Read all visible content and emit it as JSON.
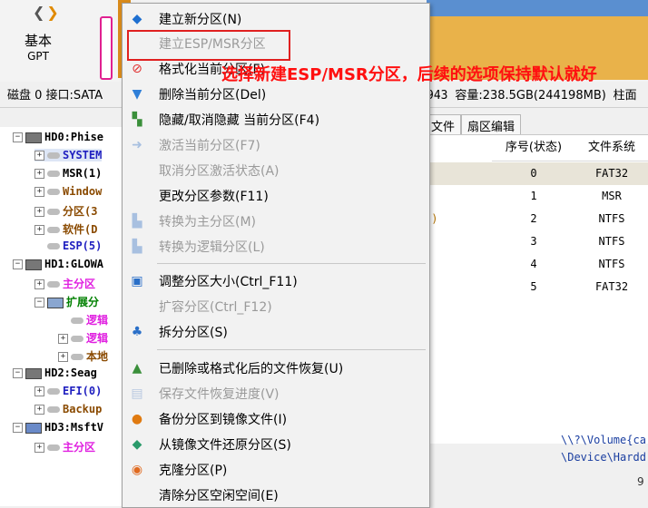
{
  "toolbar": {
    "nav_back": "❮",
    "nav_forward": "❯",
    "disk_type_title": "基本",
    "disk_type_sub": "GPT"
  },
  "disk_info": {
    "left_text": "磁盘 0 接口:SATA",
    "right_partial": "943",
    "capacity_label": "容量:238.5GB(244198MB)",
    "trailing": "柱面"
  },
  "tree": {
    "hd0": "HD0:Phise",
    "hd0_parts": [
      "SYSTEM",
      "MSR(1)",
      "Window",
      "分区(3",
      "软件(D",
      "ESP(5)"
    ],
    "hd1": "HD1:GLOWA",
    "hd1_parts": [
      "主分区",
      "扩展分"
    ],
    "hd1_sub": [
      "逻辑",
      "逻辑",
      "本地"
    ],
    "hd2": "HD2:Seag",
    "hd2_parts": [
      "EFI(0)",
      "Backup"
    ],
    "hd3": "HD3:MsftV",
    "hd3_parts": [
      "主分区"
    ]
  },
  "tabs": [
    "文件",
    "扇区编辑"
  ],
  "table": {
    "headers": [
      "序号(状态)",
      "文件系统"
    ],
    "rows": [
      {
        "index": "0",
        "fs": "FAT32"
      },
      {
        "index": "1",
        "fs": "MSR"
      },
      {
        "index": "2",
        "fs": "NTFS"
      },
      {
        "index": "3",
        "fs": "NTFS"
      },
      {
        "index": "4",
        "fs": "NTFS"
      },
      {
        "index": "5",
        "fs": "FAT32"
      }
    ],
    "fragment": ":)"
  },
  "volume_paths": [
    "\\\\?\\Volume{ca",
    "\\Device\\Hardd"
  ],
  "status_num": "9",
  "context_menu": {
    "items": [
      {
        "label": "建立新分区(N)",
        "icon": "new-partition-icon",
        "disabled": false
      },
      {
        "label": "建立ESP/MSR分区",
        "icon": "esp-msr-icon",
        "disabled": true
      },
      {
        "label": "格式化当前分区(F)",
        "icon": "format-icon",
        "disabled": false
      },
      {
        "label": "删除当前分区(Del)",
        "icon": "trash-icon",
        "disabled": false
      },
      {
        "label": "隐藏/取消隐藏 当前分区(F4)",
        "icon": "hide-icon",
        "disabled": false
      },
      {
        "label": "激活当前分区(F7)",
        "icon": "activate-icon",
        "disabled": true
      },
      {
        "label": "取消分区激活状态(A)",
        "icon": "deactivate-icon",
        "disabled": true
      },
      {
        "label": "更改分区参数(F11)",
        "icon": "params-icon",
        "disabled": false
      },
      {
        "label": "转换为主分区(M)",
        "icon": "to-primary-icon",
        "disabled": true
      },
      {
        "label": "转换为逻辑分区(L)",
        "icon": "to-logical-icon",
        "disabled": true
      },
      {
        "label": "调整分区大小(Ctrl_F11)",
        "icon": "resize-icon",
        "disabled": false
      },
      {
        "label": "扩容分区(Ctrl_F12)",
        "icon": "extend-icon",
        "disabled": true
      },
      {
        "label": "拆分分区(S)",
        "icon": "split-icon",
        "disabled": false
      },
      {
        "label": "已删除或格式化后的文件恢复(U)",
        "icon": "recover-icon",
        "disabled": false
      },
      {
        "label": "保存文件恢复进度(V)",
        "icon": "save-progress-icon",
        "disabled": true
      },
      {
        "label": "备份分区到镜像文件(I)",
        "icon": "backup-icon",
        "disabled": false
      },
      {
        "label": "从镜像文件还原分区(S)",
        "icon": "restore-icon",
        "disabled": false
      },
      {
        "label": "克隆分区(P)",
        "icon": "clone-icon",
        "disabled": false
      },
      {
        "label": "清除分区空闲空间(E)",
        "icon": "wipe-icon",
        "disabled": false
      }
    ]
  },
  "annotation": "选择新建ESP/MSR分区，后续的选项保持默认就好",
  "colors": {
    "annotation": "#ff1010",
    "highlight_box": "#e02020",
    "partition_pink": "#e020e0",
    "partition_blue": "#2020c0",
    "tree_green": "#008000",
    "tree_brown": "#8a4a00"
  }
}
